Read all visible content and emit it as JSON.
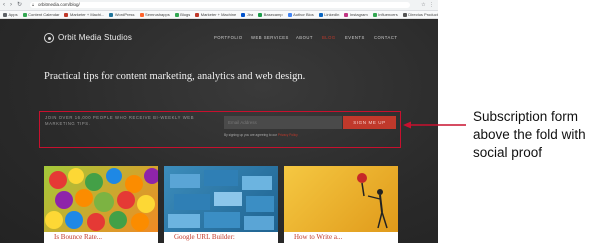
{
  "browser": {
    "url": "orbitmedia.com/blog/",
    "bookmarks": [
      {
        "label": "Apps",
        "color": "#5f6368"
      },
      {
        "label": "Content Calendar",
        "color": "#34a853"
      },
      {
        "label": "Marketer + Machi...",
        "color": "#c0392b"
      },
      {
        "label": "WordPress",
        "color": "#21759b"
      },
      {
        "label": "Semrushapps",
        "color": "#ff642d"
      },
      {
        "label": "Blogs",
        "color": "#34a853"
      },
      {
        "label": "Marketer + Machine",
        "color": "#c0392b"
      },
      {
        "label": "Jira",
        "color": "#0052cc"
      },
      {
        "label": "Basecamp",
        "color": "#1d9d4b"
      },
      {
        "label": "Author Bios",
        "color": "#4285f4"
      },
      {
        "label": "LinkedIn",
        "color": "#0a66c2"
      },
      {
        "label": "Instagram",
        "color": "#c13584"
      },
      {
        "label": "Influencers",
        "color": "#34a853"
      },
      {
        "label": "Directus Product",
        "color": "#555555"
      }
    ]
  },
  "site": {
    "logo": "Orbit Media Studios",
    "nav": [
      "PORTFOLIO",
      "WEB SERVICES",
      "ABOUT",
      "BLOG",
      "EVENTS",
      "CONTACT"
    ],
    "headline": "Practical tips for content marketing, analytics and web design.",
    "subscribe": {
      "text": "JOIN OVER 16,000 PEOPLE WHO RECEIVE BI-WEEKLY WEB MARKETING TIPS.",
      "email_placeholder": "Email Address",
      "button": "SIGN ME UP",
      "privacy_prefix": "By signing up you are agreeing to our",
      "privacy_link": "Privacy Policy"
    },
    "cards": [
      {
        "title": "Is Bounce Rate..."
      },
      {
        "title": "Google URL Builder:"
      },
      {
        "title": "How to Write a..."
      }
    ]
  },
  "annotation": {
    "lines": [
      "Subscription form",
      "above the fold with",
      "social proof"
    ]
  },
  "colors": {
    "accent": "#c0392b",
    "highlight_box": "#c8102e",
    "site_bg": "#2d2d2d"
  }
}
